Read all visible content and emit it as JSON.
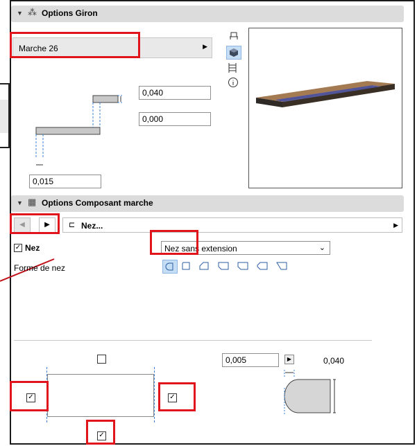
{
  "giron": {
    "title": "Options Giron",
    "preset": "Marche 26",
    "riser_value": "0,040",
    "offset_value": "0,000",
    "nosing_value": "0,015"
  },
  "component": {
    "title": "Options Composant marche",
    "selector_label": "Nez...",
    "nez_label": "Nez",
    "nez_checked": true,
    "nez_type": "Nez sans extension",
    "forme_label": "Forme de nez",
    "shapes": [
      "rounded",
      "chamfer-small",
      "chamfer",
      "bevel-both",
      "bevel-bottom",
      "bevel-top",
      "taper"
    ]
  },
  "edges": {
    "top_checked": false,
    "left_checked": true,
    "right_checked": true,
    "bottom_checked": true,
    "dim_value": "0,005",
    "dim_label": "0,040"
  },
  "colors": {
    "highlight": "#e0141b",
    "accent": "#3b7fd8",
    "section_bg": "#dcdcdc"
  }
}
